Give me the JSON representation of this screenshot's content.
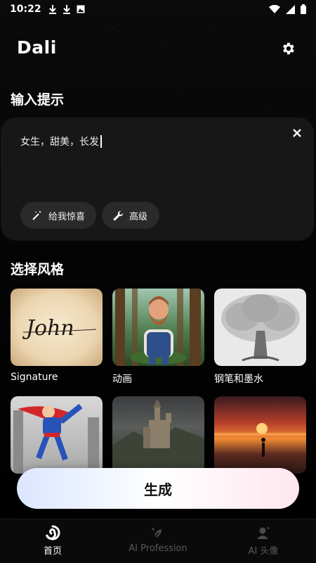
{
  "status_bar": {
    "time": "10:22"
  },
  "header": {
    "title": "Dali",
    "settings_icon": "gear-icon"
  },
  "prompt_section": {
    "title": "输入提示",
    "input_value": "女生，甜美，长发",
    "chips": [
      {
        "label": "给我惊喜",
        "icon": "magic-wand-icon"
      },
      {
        "label": "高级",
        "icon": "wrench-icon"
      }
    ]
  },
  "style_section": {
    "title": "选择风格",
    "styles": [
      {
        "label": "Signature",
        "thumbnail_text": "John"
      },
      {
        "label": "动画"
      },
      {
        "label": "钢笔和墨水"
      },
      {
        "label": ""
      },
      {
        "label": ""
      },
      {
        "label": ""
      }
    ]
  },
  "generate_button": {
    "label": "生成"
  },
  "bottom_nav": {
    "items": [
      {
        "label": "首页",
        "icon": "home-swirl-icon",
        "active": true
      },
      {
        "label": "AI Profession",
        "icon": "sparkle-leaf-icon",
        "active": false
      },
      {
        "label": "AI 头像",
        "icon": "avatar-sparkle-icon",
        "active": false
      }
    ]
  },
  "colors": {
    "background": "#000000",
    "card": "#171717",
    "chip": "#2a2a2a",
    "inactive_nav": "#5a5a5a"
  }
}
